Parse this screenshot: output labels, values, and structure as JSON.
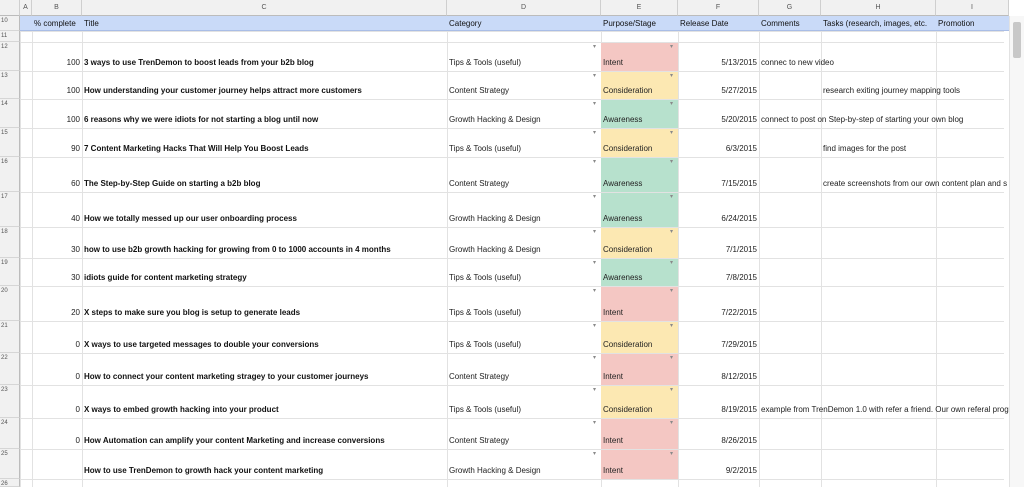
{
  "columns": [
    "A",
    "B",
    "C",
    "D",
    "E",
    "F",
    "G",
    "H",
    "I"
  ],
  "header": {
    "pct": "% complete",
    "title": "Title",
    "category": "Category",
    "stage": "Purpose/Stage",
    "release": "Release Date",
    "comments": "Comments",
    "tasks": "Tasks (research, images, etc.",
    "promotion": "Promotion"
  },
  "stage_colors": {
    "Intent": "#f4c7c3",
    "Consideration": "#fce8b2",
    "Awareness": "#b7e1cd"
  },
  "row_numbers": [
    "10",
    "11",
    "12",
    "13",
    "14",
    "15",
    "16",
    "17",
    "18",
    "19",
    "20",
    "21",
    "22",
    "23",
    "24",
    "25",
    "26"
  ],
  "rows": [
    {
      "pct": "100",
      "title": "3 ways to use TrenDemon to boost leads from your b2b blog",
      "category": "Tips & Tools (useful)",
      "stage": "Intent",
      "date": "5/13/2015",
      "comments": "connec to new video",
      "tasks": ""
    },
    {
      "pct": "100",
      "title": "How understanding your customer journey helps attract more customers",
      "category": "Content Strategy",
      "stage": "Consideration",
      "date": "5/27/2015",
      "comments": "",
      "tasks": "research exiting journey mapping tools"
    },
    {
      "pct": "100",
      "title": "6 reasons why we were idiots for not starting a blog until now",
      "category": "Growth Hacking & Design",
      "stage": "Awareness",
      "date": "5/20/2015",
      "comments": "connect to post on Step-by-step of starting your own blog",
      "tasks": ""
    },
    {
      "pct": "90",
      "title": "7 Content Marketing Hacks That Will Help You Boost Leads",
      "category": "Tips & Tools (useful)",
      "stage": "Consideration",
      "date": "6/3/2015",
      "comments": "",
      "tasks": "find images for the post"
    },
    {
      "pct": "60",
      "title": "The Step-by-Step Guide on starting a b2b blog",
      "category": "Content Strategy",
      "stage": "Awareness",
      "date": "7/15/2015",
      "comments": "",
      "tasks": "create screenshots from our own content plan and s"
    },
    {
      "pct": "40",
      "title": "How we totally messed up our user onboarding process",
      "category": "Growth Hacking & Design",
      "stage": "Awareness",
      "date": "6/24/2015",
      "comments": "",
      "tasks": ""
    },
    {
      "pct": "30",
      "title": "how to use b2b growth hacking for growing from 0 to 1000 accounts in 4 months",
      "category": "Growth Hacking & Design",
      "stage": "Consideration",
      "date": "7/1/2015",
      "comments": "",
      "tasks": ""
    },
    {
      "pct": "30",
      "title": "idiots guide for content marketing strategy",
      "category": "Tips & Tools (useful)",
      "stage": "Awareness",
      "date": "7/8/2015",
      "comments": "",
      "tasks": ""
    },
    {
      "pct": "20",
      "title": "X steps to make sure you blog is setup to generate leads",
      "category": "Tips & Tools (useful)",
      "stage": "Intent",
      "date": "7/22/2015",
      "comments": "",
      "tasks": ""
    },
    {
      "pct": "0",
      "title": "X ways to use targeted messages to double your conversions",
      "category": "Tips & Tools (useful)",
      "stage": "Consideration",
      "date": "7/29/2015",
      "comments": "",
      "tasks": ""
    },
    {
      "pct": "0",
      "title": "How to connect your content marketing stragey to your customer journeys",
      "category": "Content Strategy",
      "stage": "Intent",
      "date": "8/12/2015",
      "comments": "",
      "tasks": ""
    },
    {
      "pct": "0",
      "title": "X ways to embed growth hacking into your product",
      "category": "Tips & Tools (useful)",
      "stage": "Consideration",
      "date": "8/19/2015",
      "comments": "example from TrenDemon 1.0 with refer a friend. Our own referal progr",
      "tasks": ""
    },
    {
      "pct": "0",
      "title": "How Automation can amplify your content Marketing and increase conversions",
      "category": "Content Strategy",
      "stage": "Intent",
      "date": "8/26/2015",
      "comments": "",
      "tasks": ""
    },
    {
      "pct": "",
      "title": "How to use TrenDemon to growth hack your content marketing",
      "category": "Growth Hacking & Design",
      "stage": "Intent",
      "date": "9/2/2015",
      "comments": "",
      "tasks": ""
    }
  ]
}
